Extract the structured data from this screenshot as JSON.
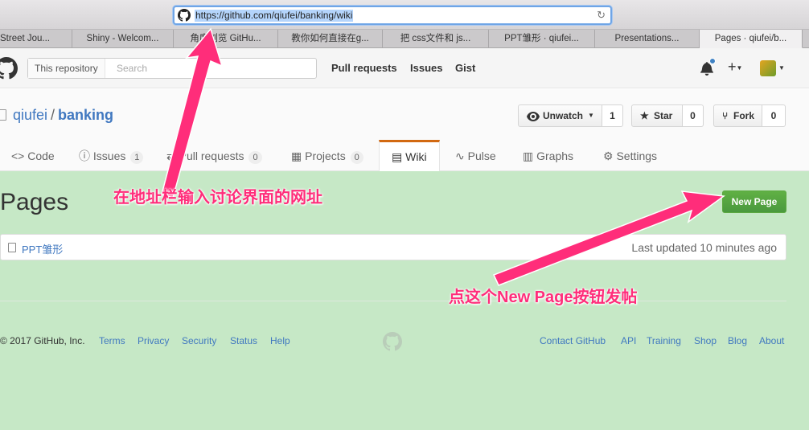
{
  "browser": {
    "url": "https://github.com/qiufei/banking/wiki",
    "tabs": [
      {
        "label": "Street Jou..."
      },
      {
        "label": "Shiny - Welcom..."
      },
      {
        "label": "角度浏览 GitHu..."
      },
      {
        "label": "教你如何直接在g..."
      },
      {
        "label": "把 css文件和 js..."
      },
      {
        "label": "PPT雏形 · qiufei..."
      },
      {
        "label": "Presentations..."
      },
      {
        "label": "Pages · qiufei/b..."
      }
    ]
  },
  "header": {
    "search_scope": "This repository",
    "search_placeholder": "Search",
    "nav": [
      "Pull requests",
      "Issues",
      "Gist"
    ],
    "plus": "+"
  },
  "repo": {
    "owner": "qiufei",
    "separator": "/",
    "name": "banking",
    "unwatch_label": "Unwatch",
    "watch_count": "1",
    "star_label": "Star",
    "star_count": "0",
    "fork_label": "Fork",
    "fork_count": "0",
    "tabs": {
      "code": "Code",
      "issues": "Issues",
      "issues_count": "1",
      "pulls": "Pull requests",
      "pulls_count": "0",
      "projects": "Projects",
      "projects_count": "0",
      "wiki": "Wiki",
      "pulse": "Pulse",
      "graphs": "Graphs",
      "settings": "Settings"
    }
  },
  "wiki": {
    "title": "Pages",
    "new_page_label": "New Page",
    "pages": [
      {
        "name": "PPT雏形",
        "updated": "Last updated 10 minutes ago"
      }
    ]
  },
  "footer": {
    "copyright": "© 2017 GitHub, Inc.",
    "left_links": [
      "Terms",
      "Privacy",
      "Security",
      "Status",
      "Help"
    ],
    "right_links": [
      "Contact GitHub",
      "API",
      "Training",
      "Shop",
      "Blog",
      "About"
    ]
  },
  "annotations": {
    "address_bar_note": "在地址栏输入讨论界面的网址",
    "new_page_note": "点这个New Page按钮发帖",
    "color": "#ff2d7a"
  },
  "colors": {
    "link": "#4078c0",
    "new_page_green": "#5ca941",
    "wiki_tab_accent": "#d26911",
    "overlay_green": "#c6e8c6"
  }
}
